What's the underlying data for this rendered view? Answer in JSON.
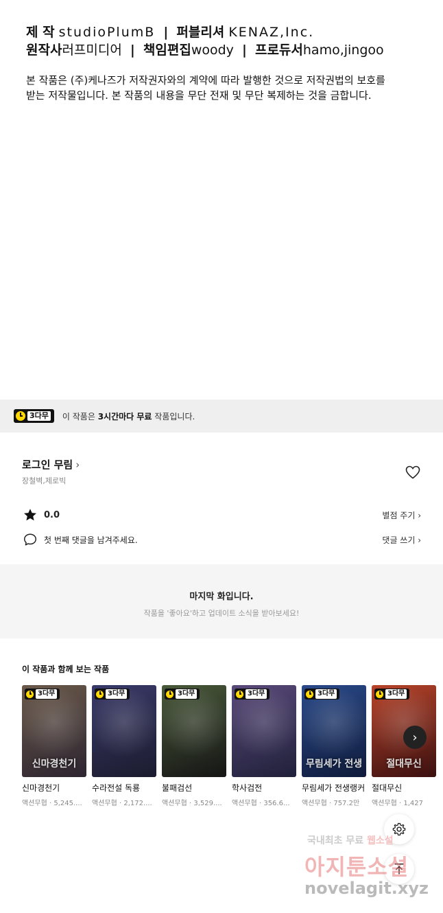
{
  "credits": {
    "line1": {
      "producer_label": "제 작",
      "producer_value": "studioPlumB",
      "publisher_label": "퍼블리셔",
      "publisher_value": "KENAZ,Inc."
    },
    "line2": {
      "original_label": "원작사",
      "original_value": "러프미디어",
      "editor_label": "책임편집",
      "editor_value": "woody",
      "producer2_label": "프로듀서",
      "producer2_value": "hamo,jingoo"
    },
    "separator": "|",
    "copyright_line1": "본 작품은 (주)케나즈가 저작권자와의 계약에 따라 발행한 것으로 저작권법의 보호를",
    "copyright_line2": "받는 저작물입니다. 본 작품의 내용을 무단 전재 및 무단 복제하는 것을 금합니다."
  },
  "free_banner": {
    "badge": "3다무",
    "text_prefix": "이 작품은 ",
    "text_bold": "3시간마다 무료",
    "text_suffix": " 작품입니다."
  },
  "work": {
    "title": "로그인 무림",
    "title_chevron": "›",
    "authors": "장철벽,제로빅",
    "rating": "0.0",
    "rate_action": "별점 주기 ›",
    "comment_prompt": "첫 번째 댓글을 남겨주세요.",
    "comment_action": "댓글 쓰기 ›"
  },
  "last_episode": {
    "title": "마지막 화입니다.",
    "subtitle": "작품을 '좋아요'하고 업데이트 소식을 받아보세요!"
  },
  "related": {
    "title": "이 작품과 함께 보는 작품",
    "items": [
      {
        "name": "신마경천기",
        "meta": "액션무협 · 5,245....",
        "badge": "3다무",
        "logo": "신마경천기",
        "color1": "#6b5a4a",
        "color2": "#2c2430"
      },
      {
        "name": "수라전설 독룡",
        "meta": "액션무협 · 2,172....",
        "badge": "3다무",
        "logo": "",
        "color1": "#3a3a6a",
        "color2": "#1b1b2e"
      },
      {
        "name": "불패검선",
        "meta": "액션무협 · 3,529....",
        "badge": "3다무",
        "logo": "",
        "color1": "#4a5a3a",
        "color2": "#151515"
      },
      {
        "name": "학사검전",
        "meta": "액션무협 · 356.6...",
        "badge": "3다무",
        "logo": "",
        "color1": "#5a4a7a",
        "color2": "#20203a"
      },
      {
        "name": "무림세가 전생랭커",
        "meta": "액션무협 · 757.2만",
        "badge": "3다무",
        "logo": "무림세가 전생랭커",
        "color1": "#2a4a8a",
        "color2": "#0f1b3a"
      },
      {
        "name": "절대무신",
        "meta": "액션무협 · 1,427",
        "badge": "3다무",
        "logo": "절대무신",
        "color1": "#b8442a",
        "color2": "#3a1010"
      }
    ]
  },
  "next_button": "›",
  "watermark": {
    "line1": "국내최초 무료 ",
    "line1_highlight": "웹소설",
    "line2": "아지툰소설",
    "line3": "novelagit.xyz"
  }
}
